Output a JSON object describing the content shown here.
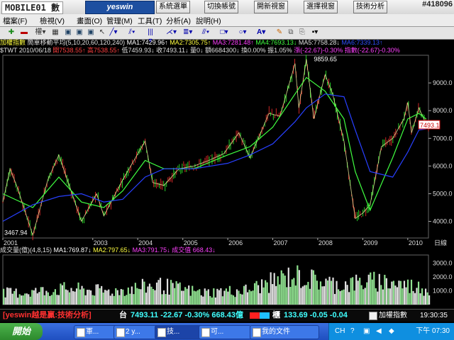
{
  "top": {
    "logo": "MOBILE01 數",
    "brand": "yeswin",
    "buttons": [
      "系統選單",
      "切換帳號",
      "開新視窗",
      "選擇視窗",
      "技術分析"
    ],
    "watermark": "#418096"
  },
  "menu": [
    "檔案(F)",
    "檢視(V)",
    "畫面(O)",
    "管理(M)",
    "工具(T)",
    "分析(A)",
    "說明(H)"
  ],
  "toolbar_icons": [
    "plus-icon",
    "minus-icon",
    "period-icon",
    "grid-icon",
    "window-icon",
    "window2-icon",
    "window3-icon",
    "cursor-icon",
    "line-icon",
    "parallel-icon",
    "bars-icon",
    "fan-icon",
    "level-icon",
    "rect-icon",
    "ellipse-icon",
    "text-icon",
    "eraser-icon",
    "copy-icon",
    "paste-icon",
    "save-icon"
  ],
  "price_header": {
    "name": "加權指數",
    "ma_title": "簡單移動平均(5,10,20,60,120,240)",
    "ma1": "MA1:7429.96↑",
    "ma2": "MA2:7305.75↑",
    "ma3": "MA3:7281.48↑",
    "ma4": "MA4:7693.13↓",
    "ma5": "MA5:7758.28↓",
    "ma6": "MA6:7339.13↑"
  },
  "quote_line": {
    "symbol": "$TWT",
    "date": "2010/06/18",
    "open": "開7538.55↑",
    "high": "高7538.55↑",
    "low": "低7459.93↓",
    "close": "收7493.11↓",
    "vol": "量0↓",
    "amount": "額6684300↓",
    "turnover": "換0.00%",
    "amplitude": "振1.05%",
    "change": "漲(-22.67)-0.30%",
    "index": "指數(-22.67)-0.30%"
  },
  "chart_labels": {
    "high_mark": "9859.65",
    "low_mark": "3467.94",
    "current": "7493.1",
    "unit": "日線",
    "y_ticks": [
      "9000.0",
      "8000.0",
      "7000.0",
      "6000.0",
      "5000.0",
      "4000.0"
    ],
    "x_ticks": [
      "2001",
      "2003",
      "2004",
      "2005",
      "2006",
      "2007",
      "2008",
      "2009",
      "2010"
    ],
    "vol_ticks": [
      "3000.0",
      "2000.0",
      "1000.0"
    ]
  },
  "volume_header": {
    "title": "成交量(億)(4,8,15)",
    "ma1": "MA1:769.87↓",
    "ma2": "MA2:797.65↓",
    "ma3": "MA3:791.75↓",
    "value": "成交值 668.43↓"
  },
  "status": {
    "slogan": "[yeswin越是贏:技術分析]",
    "market1": "台",
    "quote1": "7493.11 -22.67 -0.30% 668.43億",
    "market2": "櫃",
    "quote2": "133.69 -0.05 -0.04",
    "index_label": "加權指數",
    "time": "19:30:35"
  },
  "taskbar": {
    "start": "開始",
    "tasks": [
      "軍...",
      "2 y...",
      "技...",
      "可...",
      "我的文件"
    ],
    "lang": "CH",
    "clock": "下午 07:30"
  },
  "chart_data": {
    "type": "line",
    "title": "加權指數",
    "x_range": [
      "2001",
      "2010/06/18"
    ],
    "ylim": [
      3400,
      10000
    ],
    "series": [
      {
        "name": "加權指數",
        "x": [
          "2001-01",
          "2001-03",
          "2001-05",
          "2001-09",
          "2002-01",
          "2002-04",
          "2002-08",
          "2002-10",
          "2003-02",
          "2003-04",
          "2003-09",
          "2004-03",
          "2004-05",
          "2004-08",
          "2004-12",
          "2005-04",
          "2005-08",
          "2005-12",
          "2006-04",
          "2006-07",
          "2006-12",
          "2007-03",
          "2007-07",
          "2007-08",
          "2007-10",
          "2007-12",
          "2008-03",
          "2008-05",
          "2008-08",
          "2008-11",
          "2009-01",
          "2009-03",
          "2009-06",
          "2009-09",
          "2009-12",
          "2010-01",
          "2010-02",
          "2010-04",
          "2010-06"
        ],
        "values": [
          4700,
          5900,
          5200,
          3500,
          5500,
          6400,
          4800,
          4000,
          5000,
          4200,
          5500,
          6900,
          5400,
          5300,
          5900,
          6000,
          6200,
          6450,
          7200,
          6300,
          7900,
          7800,
          9700,
          8100,
          9859,
          7700,
          9300,
          8600,
          6900,
          4100,
          4300,
          4600,
          6700,
          7000,
          7700,
          8300,
          7200,
          8100,
          7493
        ]
      },
      {
        "name": "MA4",
        "x": [
          "2001-01",
          "2001-09",
          "2002-04",
          "2002-10",
          "2003-04",
          "2003-09",
          "2004-03",
          "2004-08",
          "2005-04",
          "2006-01",
          "2006-07",
          "2007-01",
          "2007-07",
          "2007-10",
          "2008-03",
          "2008-08",
          "2008-11",
          "2009-03",
          "2009-09",
          "2010-01",
          "2010-04",
          "2010-06"
        ],
        "values": [
          5000,
          4500,
          5600,
          4700,
          4500,
          5100,
          6200,
          5900,
          5900,
          6400,
          6700,
          7400,
          8600,
          9200,
          8700,
          7700,
          5800,
          4400,
          6300,
          7700,
          7900,
          7693
        ]
      },
      {
        "name": "MA6",
        "x": [
          "2001-01",
          "2001-09",
          "2002-04",
          "2002-10",
          "2003-04",
          "2003-09",
          "2004-03",
          "2004-08",
          "2005-04",
          "2006-01",
          "2006-07",
          "2007-01",
          "2007-07",
          "2007-10",
          "2008-03",
          "2008-08",
          "2008-11",
          "2009-03",
          "2009-09",
          "2010-01",
          "2010-04",
          "2010-06"
        ],
        "values": [
          4000,
          4600,
          4900,
          5000,
          4700,
          4800,
          5600,
          5900,
          5900,
          6100,
          6400,
          6800,
          7600,
          8100,
          8600,
          8500,
          7300,
          5800,
          5600,
          6500,
          7300,
          7339
        ]
      }
    ],
    "volume": {
      "name": "成交量(億)",
      "ylim": [
        0,
        3600
      ],
      "x": [
        "2001",
        "2002",
        "2003",
        "2004",
        "2005",
        "2006",
        "2007",
        "2008",
        "2009",
        "2010"
      ],
      "values": [
        900,
        1200,
        1000,
        1500,
        900,
        1100,
        2200,
        1500,
        1800,
        1200
      ]
    }
  }
}
